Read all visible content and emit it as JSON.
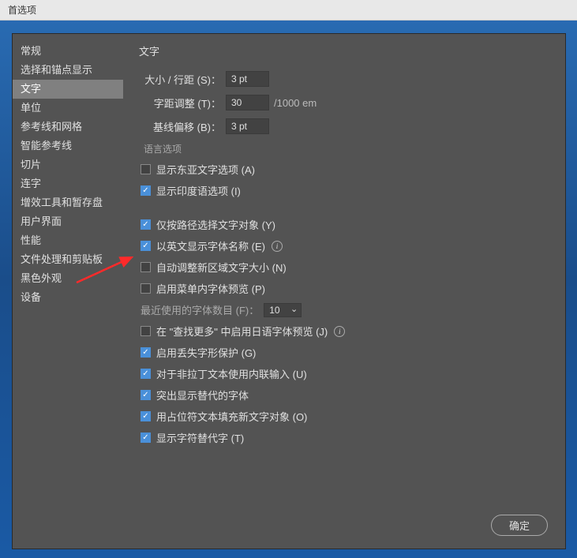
{
  "titlebar": "首选项",
  "sidebar": {
    "items": [
      {
        "label": "常规"
      },
      {
        "label": "选择和锚点显示"
      },
      {
        "label": "文字",
        "active": true
      },
      {
        "label": "单位"
      },
      {
        "label": "参考线和网格"
      },
      {
        "label": "智能参考线"
      },
      {
        "label": "切片"
      },
      {
        "label": "连字"
      },
      {
        "label": "增效工具和暂存盘"
      },
      {
        "label": "用户界面"
      },
      {
        "label": "性能"
      },
      {
        "label": "文件处理和剪贴板"
      },
      {
        "label": "黑色外观"
      },
      {
        "label": "设备"
      }
    ]
  },
  "content": {
    "title": "文字",
    "fields": {
      "size_leading": {
        "label": "大小 / 行距 (S)：",
        "value": "3 pt"
      },
      "tracking": {
        "label": "字距调整 (T)：",
        "value": "30",
        "suffix": "/1000 em"
      },
      "baseline": {
        "label": "基线偏移 (B)：",
        "value": "3 pt"
      }
    },
    "lang_section": "语言选项",
    "checkboxes": {
      "east_asian": {
        "label": "显示东亚文字选项 (A)",
        "checked": false
      },
      "indic": {
        "label": "显示印度语选项 (I)",
        "checked": true
      },
      "path_only": {
        "label": "仅按路径选择文字对象 (Y)",
        "checked": true
      },
      "english_font": {
        "label": "以英文显示字体名称 (E)",
        "checked": true,
        "info": true
      },
      "auto_resize": {
        "label": "自动调整新区域文字大小 (N)",
        "checked": false
      },
      "menu_preview": {
        "label": "启用菜单内字体预览 (P)",
        "checked": false
      },
      "jp_preview": {
        "label": "在 \"查找更多\" 中启用日语字体预览 (J)",
        "checked": false,
        "info": true
      },
      "missing_glyph": {
        "label": "启用丢失字形保护 (G)",
        "checked": true
      },
      "inline_input": {
        "label": "对于非拉丁文本使用内联输入 (U)",
        "checked": true
      },
      "highlight_alt": {
        "label": "突出显示替代的字体",
        "checked": true
      },
      "placeholder_fill": {
        "label": "用占位符文本填充新文字对象 (O)",
        "checked": true
      },
      "char_alt": {
        "label": "显示字符替代字 (T)",
        "checked": true
      }
    },
    "recent_fonts": {
      "label": "最近使用的字体数目 (F)：",
      "value": "10"
    },
    "ok_button": "确定"
  }
}
